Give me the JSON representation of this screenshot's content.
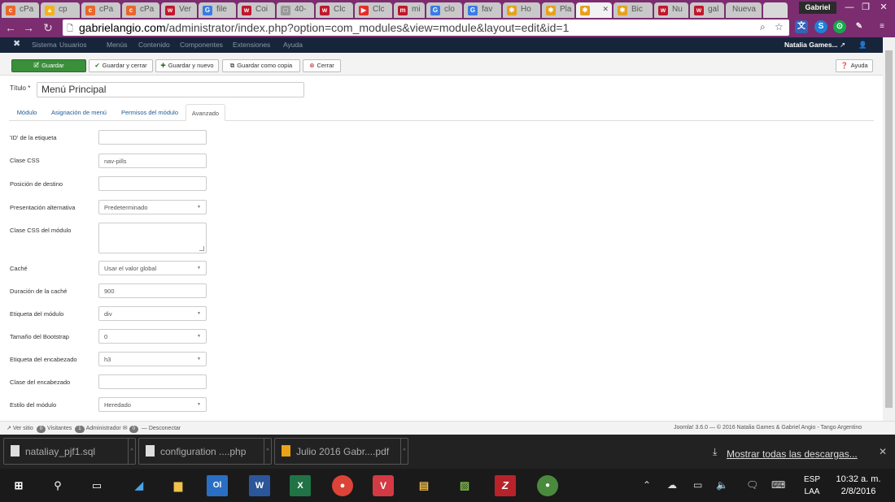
{
  "browser": {
    "tabs": [
      "cPa",
      "cp",
      "cPa",
      "cPa",
      "Ver",
      "file",
      "Coi",
      "40-",
      "Clc",
      "Clc",
      "mi",
      "clo",
      "fav",
      "Ho",
      "Pla",
      "",
      "Bic",
      "Nu",
      "gal",
      "Nueva"
    ],
    "active_tab_index": 15,
    "window_user": "Gabriel",
    "url_host": "gabrielangio.com",
    "url_path": "/administrator/index.php?option=com_modules&view=module&layout=edit&id=1"
  },
  "joomla_nav": {
    "items": [
      "Sistema",
      "Usuarios",
      "Menús",
      "Contenido",
      "Componentes",
      "Extensiones",
      "Ayuda"
    ],
    "user": "Natalia Games..."
  },
  "toolbar": {
    "save": "Guardar",
    "save_close": "Guardar y cerrar",
    "save_new": "Guardar y nuevo",
    "save_copy": "Guardar como copia",
    "close": "Cerrar",
    "help": "Ayuda"
  },
  "form": {
    "title_label": "Título *",
    "title_value": "Menú Principal",
    "tabs": [
      "Módulo",
      "Asignación de menú",
      "Permisos del módulo",
      "Avanzado"
    ],
    "active_tab": 3,
    "fields": [
      {
        "label": "'ID' de la etiqueta",
        "value": ""
      },
      {
        "label": "Clase CSS",
        "value": "nav-pills"
      },
      {
        "label": "Posición de destino",
        "value": ""
      },
      {
        "label": "Presentación alternativa",
        "value": "Predeterminado"
      },
      {
        "label": "Clase CSS del módulo",
        "value": ""
      },
      {
        "label": "Caché",
        "value": "Usar el valor global"
      },
      {
        "label": "Duración de la caché",
        "value": "900"
      },
      {
        "label": "Etiqueta del módulo",
        "value": "div"
      },
      {
        "label": "Tamaño del Bootstrap",
        "value": "0"
      },
      {
        "label": "Etiqueta del encabezado",
        "value": "h3"
      },
      {
        "label": "Clase del encabezado",
        "value": ""
      },
      {
        "label": "Estilo del módulo",
        "value": "Heredado"
      }
    ]
  },
  "statusbar": {
    "view_site": "Ver sitio",
    "visitors_count": "0",
    "visitors": "Visitantes",
    "admins_count": "1",
    "admins": "Administrador",
    "messages_count": "0",
    "logout": "— Desconectar",
    "footer": "Joomla! 3.6.0 — © 2016 Natalia Games & Gabriel Angio - Tango Argentino"
  },
  "downloads": {
    "items": [
      "nataliay_pjf1.sql",
      "configuration ....php",
      "Julio 2016 Gabr....pdf"
    ],
    "show_all": "Mostrar todas las descargas..."
  },
  "taskbar": {
    "lang1": "ESP",
    "lang2": "LAA",
    "time": "10:32 a. m.",
    "date": "2/8/2016"
  }
}
